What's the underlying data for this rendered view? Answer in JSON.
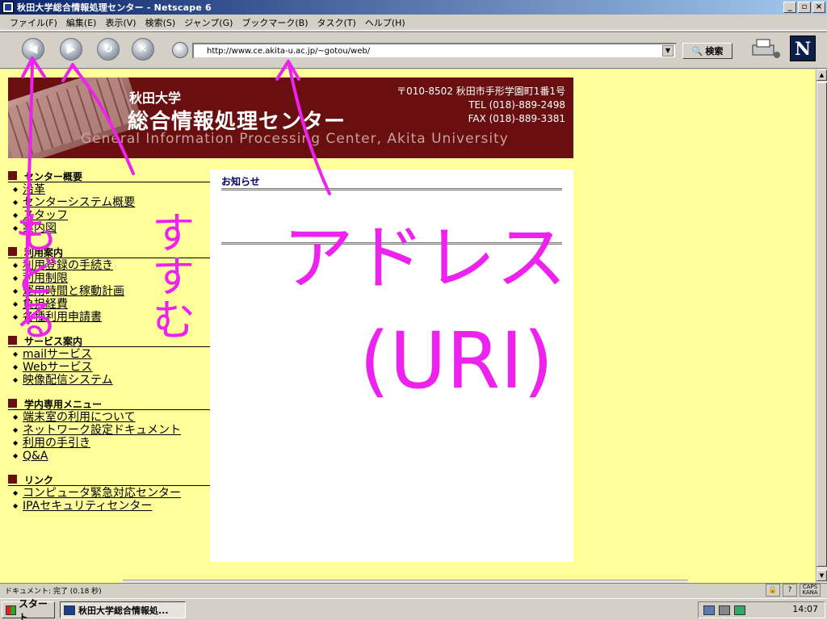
{
  "window": {
    "title": "秋田大学総合情報処理センター - Netscape 6"
  },
  "menu": [
    "ファイル(F)",
    "編集(E)",
    "表示(V)",
    "検索(S)",
    "ジャンプ(G)",
    "ブックマーク(B)",
    "タスク(T)",
    "ヘルプ(H)"
  ],
  "toolbar": {
    "url": "http://www.ce.akita-u.ac.jp/~gotou/web/",
    "search_label": "検索",
    "logo": "N"
  },
  "banner": {
    "university": "秋田大学",
    "center": "総合情報処理センター",
    "english": "General Information Processing Center, Akita University",
    "address": "〒010-8502 秋田市手形学園町1番1号\nTEL (018)-889-2498\nFAX (018)-889-3381"
  },
  "sidebar": [
    {
      "title": "センター概要",
      "items": [
        "沿革",
        "センターシステム概要",
        "スタッフ",
        "案内図"
      ]
    },
    {
      "title": "利用案内",
      "items": [
        "利用登録の手続き",
        "利用制限",
        "運用時間と稼動計画",
        "負担経費",
        "各種利用申請書"
      ]
    },
    {
      "title": "サービス案内",
      "items": [
        "mailサービス",
        "Webサービス",
        "映像配信システム"
      ]
    },
    {
      "title": "学内専用メニュー",
      "items": [
        "端末室の利用について",
        "ネットワーク設定ドキュメント",
        "利用の手引き",
        "Q&A"
      ]
    },
    {
      "title": "リンク",
      "items": [
        "コンピュータ緊急対応センター",
        "IPAセキュリティセンター"
      ]
    }
  ],
  "notice": {
    "title": "お知らせ"
  },
  "annotations": {
    "left_text": "もどる",
    "mid_text": "すすむ",
    "right_text_1": "アドレス",
    "right_text_2": "(URI)",
    "color": "#ee22ee"
  },
  "status": {
    "text": "ドキュメント: 完了 (0.18 秒)"
  },
  "taskbar": {
    "start": "スタート",
    "task": "秋田大学総合情報処...",
    "clock": "14:07"
  }
}
